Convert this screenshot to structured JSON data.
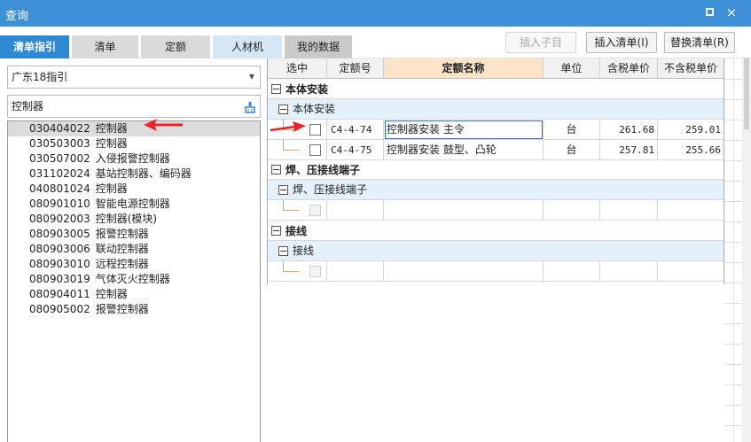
{
  "window": {
    "title": "查询",
    "restore_icon": "restore-icon",
    "close_icon": "close-icon",
    "close_glyph": "×"
  },
  "tabs": [
    {
      "label": "清单指引",
      "active": true
    },
    {
      "label": "清单"
    },
    {
      "label": "定额"
    },
    {
      "label": "人材机"
    },
    {
      "label": "我的数据"
    }
  ],
  "toolbar": {
    "insert_child_label": "插入子目",
    "insert_list_label": "插入清单(I)",
    "replace_list_label": "替换清单(R)"
  },
  "left": {
    "region_select": "广东18指引",
    "search_value": "控制器",
    "search_icon": "broom-clear-icon",
    "items": [
      {
        "code": "030404022",
        "name": "控制器",
        "selected": true
      },
      {
        "code": "030503003",
        "name": "控制器"
      },
      {
        "code": "030507002",
        "name": "入侵报警控制器"
      },
      {
        "code": "031102024",
        "name": "基站控制器、编码器"
      },
      {
        "code": "040801024",
        "name": "控制器"
      },
      {
        "code": "080901010",
        "name": "智能电源控制器"
      },
      {
        "code": "080902003",
        "name": "控制器(模块)"
      },
      {
        "code": "080903005",
        "name": "报警控制器"
      },
      {
        "code": "080903006",
        "name": "联动控制器"
      },
      {
        "code": "080903010",
        "name": "远程控制器"
      },
      {
        "code": "080903019",
        "name": "气体灭火控制器"
      },
      {
        "code": "080904011",
        "name": "控制器"
      },
      {
        "code": "080905002",
        "name": "报警控制器"
      }
    ]
  },
  "grid": {
    "headers": {
      "select": "选中",
      "code": "定额号",
      "name": "定额名称",
      "unit": "单位",
      "price_tax": "含税单价",
      "price_notax": "不含税单价"
    },
    "groups": [
      {
        "title": "本体安装",
        "subtitle": "本体安装",
        "rows": [
          {
            "code": "C4-4-74",
            "name": "控制器安装 主令",
            "unit": "台",
            "price_tax": "261.68",
            "price_notax": "259.01"
          },
          {
            "code": "C4-4-75",
            "name": "控制器安装 鼓型、凸轮",
            "unit": "台",
            "price_tax": "257.81",
            "price_notax": "255.66"
          }
        ]
      },
      {
        "title": "焊、压接线端子",
        "subtitle": "焊、压接线端子",
        "rows": [
          {
            "code": "",
            "name": "",
            "unit": "",
            "price_tax": "",
            "price_notax": ""
          }
        ]
      },
      {
        "title": "接线",
        "subtitle": "接线",
        "rows": [
          {
            "code": "",
            "name": "",
            "unit": "",
            "price_tax": "",
            "price_notax": ""
          }
        ]
      }
    ]
  },
  "colors": {
    "title_bar": "#3d8fd6",
    "active_tab": "#2f88d4",
    "arrow": "#e8232a",
    "header_highlight": "#fbe4c8"
  }
}
